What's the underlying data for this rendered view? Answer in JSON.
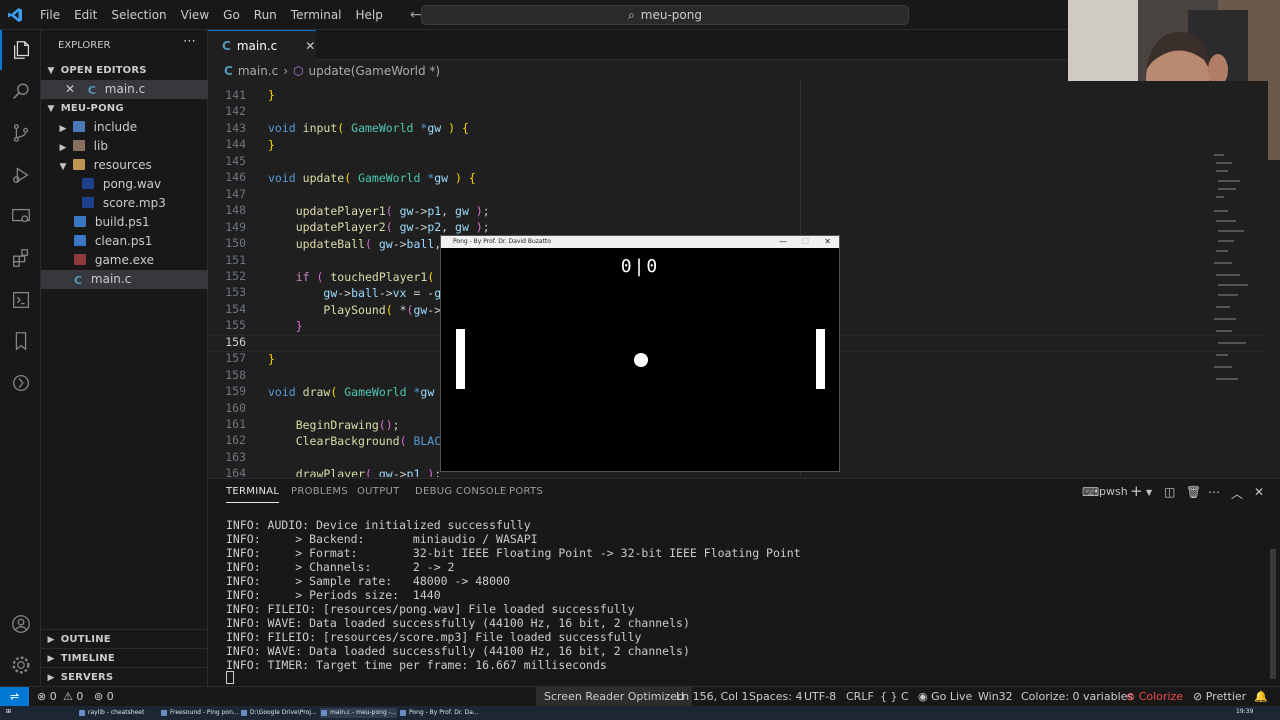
{
  "titlebar": {
    "menu": [
      "File",
      "Edit",
      "Selection",
      "View",
      "Go",
      "Run",
      "Terminal",
      "Help"
    ],
    "search": "meu-pong"
  },
  "sidebar": {
    "title": "EXPLORER",
    "open_editors_label": "OPEN EDITORS",
    "open_file": "main.c",
    "project": "MEU-PONG",
    "items": [
      {
        "label": "include",
        "kind": "folder"
      },
      {
        "label": "lib",
        "kind": "folder"
      },
      {
        "label": "resources",
        "kind": "folder-open"
      },
      {
        "label": "pong.wav",
        "kind": "audio"
      },
      {
        "label": "score.mp3",
        "kind": "audio"
      },
      {
        "label": "build.ps1",
        "kind": "powershell"
      },
      {
        "label": "clean.ps1",
        "kind": "powershell"
      },
      {
        "label": "game.exe",
        "kind": "exe"
      },
      {
        "label": "main.c",
        "kind": "c"
      }
    ],
    "outline": "OUTLINE",
    "timeline": "TIMELINE",
    "servers": "SERVERS"
  },
  "editor": {
    "tab": "main.c",
    "breadcrumb": {
      "file": "main.c",
      "symbol": "update(GameWorld *)"
    },
    "line_numbers": [
      "141",
      "142",
      "143",
      "144",
      "145",
      "146",
      "147",
      "148",
      "149",
      "150",
      "151",
      "152",
      "153",
      "154",
      "155",
      "156",
      "157",
      "158",
      "159",
      "160",
      "161",
      "162",
      "163",
      "164"
    ],
    "active_line": "156"
  },
  "pong": {
    "title": "Pong - By Prof. Dr. David Buzatto",
    "score": "0|0"
  },
  "panel": {
    "tabs": [
      "TERMINAL",
      "PROBLEMS",
      "OUTPUT",
      "DEBUG CONSOLE",
      "PORTS"
    ],
    "shell": "pwsh",
    "lines": [
      "INFO: AUDIO: Device initialized successfully",
      "INFO:     > Backend:       miniaudio / WASAPI",
      "INFO:     > Format:        32-bit IEEE Floating Point -> 32-bit IEEE Floating Point",
      "INFO:     > Channels:      2 -> 2",
      "INFO:     > Sample rate:   48000 -> 48000",
      "INFO:     > Periods size:  1440",
      "INFO: FILEIO: [resources/pong.wav] File loaded successfully",
      "INFO: WAVE: Data loaded successfully (44100 Hz, 16 bit, 2 channels)",
      "INFO: FILEIO: [resources/score.mp3] File loaded successfully",
      "INFO: WAVE: Data loaded successfully (44100 Hz, 16 bit, 2 channels)",
      "INFO: TIMER: Target time per frame: 16.667 milliseconds"
    ]
  },
  "statusbar": {
    "errors": "0",
    "warnings": "0",
    "ports": "0",
    "screen_reader": "Screen Reader Optimized",
    "position": "Ln 156, Col 1",
    "spaces": "Spaces: 4",
    "encoding": "UTF-8",
    "eol": "CRLF",
    "language": "C",
    "go_live": "Go Live",
    "platform": "Win32",
    "colorize_vars": "Colorize: 0 variables",
    "colorize": "Colorize",
    "prettier": "Prettier"
  },
  "taskbar": {
    "items": [
      "raylib - cheatsheet",
      "Freesound - Ping pon...",
      "D:\\Google Drive\\Proj...",
      "main.c - meu-pong -...",
      "Pong - By Prof. Dr. Da..."
    ],
    "clock": "19:39"
  }
}
